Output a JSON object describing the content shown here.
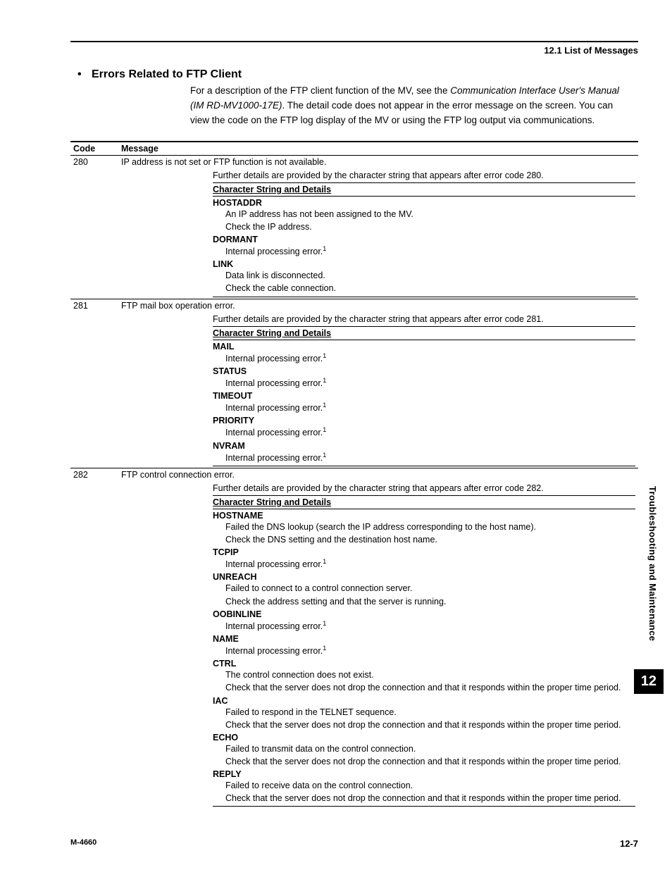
{
  "header": {
    "section": "12.1  List of Messages"
  },
  "title": "Errors Related to FTP Client",
  "intro": {
    "p1a": "For a description of the FTP client function of the MV, see the ",
    "p1b": "Communication Interface User's Manual (IM RD-MV1000-17E)",
    "p1c": ". The detail code does not appear in the error message on the screen. You can view the code on the FTP log display of the MV or using the FTP log output via communications."
  },
  "table": {
    "headers": {
      "code": "Code",
      "message": "Message"
    },
    "detail_label": "Character String and Details",
    "rows": [
      {
        "code": "280",
        "message": "IP address is not set or FTP function is not available.",
        "detail_intro": "Further details are provided by the character string that appears after error code 280.",
        "items": [
          {
            "term": "HOSTADDR",
            "lines": [
              "An IP address has not been assigned to the MV.",
              "Check the IP address."
            ]
          },
          {
            "term": "DORMANT",
            "lines": [
              "Internal processing error."
            ],
            "sup": "1"
          },
          {
            "term": "LINK",
            "lines": [
              "Data link is disconnected.",
              "Check the cable connection."
            ]
          }
        ]
      },
      {
        "code": "281",
        "message": "FTP mail box operation error.",
        "detail_intro": "Further details are provided by the character string that appears after error code 281.",
        "items": [
          {
            "term": "MAIL",
            "lines": [
              "Internal processing error."
            ],
            "sup": "1"
          },
          {
            "term": "STATUS",
            "lines": [
              "Internal processing error."
            ],
            "sup": "1"
          },
          {
            "term": "TIMEOUT",
            "lines": [
              "Internal processing error."
            ],
            "sup": "1"
          },
          {
            "term": "PRIORITY",
            "lines": [
              "Internal processing error."
            ],
            "sup": "1"
          },
          {
            "term": "NVRAM",
            "lines": [
              "Internal processing error."
            ],
            "sup": "1"
          }
        ]
      },
      {
        "code": "282",
        "message": "FTP control connection error.",
        "detail_intro": "Further details are provided by the character string that appears after error code 282.",
        "items": [
          {
            "term": "HOSTNAME",
            "lines": [
              "Failed the DNS lookup (search the IP address corresponding to the host name).",
              "Check the DNS setting and the destination host name."
            ]
          },
          {
            "term": "TCPIP",
            "lines": [
              "Internal processing error."
            ],
            "sup": "1"
          },
          {
            "term": "UNREACH",
            "lines": [
              "Failed to connect to a control connection server.",
              "Check the address setting and that the server is running."
            ]
          },
          {
            "term": "OOBINLINE",
            "lines": [
              "Internal processing error."
            ],
            "sup": "1"
          },
          {
            "term": "NAME",
            "lines": [
              "Internal processing error."
            ],
            "sup": "1"
          },
          {
            "term": "CTRL",
            "lines": [
              "The control connection does not exist.",
              "Check that the server does not drop the connection and that it responds within the proper time period."
            ]
          },
          {
            "term": "IAC",
            "lines": [
              "Failed to respond in the TELNET sequence.",
              "Check that the server does not drop the connection and that it responds within the proper time period."
            ]
          },
          {
            "term": "ECHO",
            "lines": [
              "Failed to transmit data on the control connection.",
              "Check that the server does not drop the connection and that it responds within the proper time period."
            ]
          },
          {
            "term": "REPLY",
            "lines": [
              "Failed to receive data on the control connection.",
              "Check that the server does not drop the connection and that it responds within the proper time period."
            ]
          }
        ]
      }
    ]
  },
  "side": {
    "label": "Troubleshooting and Maintenance",
    "chapter": "12"
  },
  "footer": {
    "doc": "M-4660",
    "page": "12-7"
  }
}
